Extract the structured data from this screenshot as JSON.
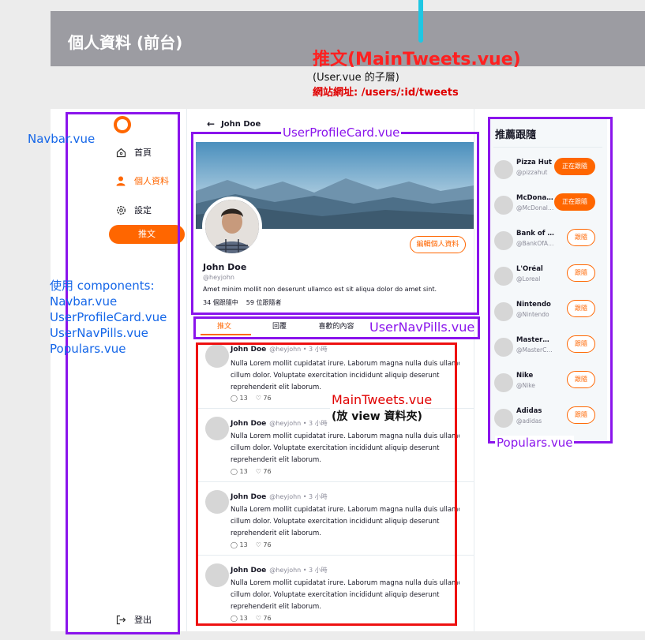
{
  "header": {
    "title": "個人資料 (前台)"
  },
  "annotation": {
    "main_title": "推文(MainTweets.vue)",
    "sub1": "(User.vue 的子層)",
    "sub2": "網站網址: /users/:id/tweets",
    "navbar_label": "Navbar.vue",
    "profilecard_label": "UserProfileCard.vue",
    "navpills_label": "UserNavPills.vue",
    "populars_label": "Populars.vue",
    "maintweets_label": "MainTweets.vue",
    "maintweets_sub": "(放 view 資料夾)",
    "components_title": "使用 components:",
    "components": [
      "Navbar.vue",
      "UserProfileCard.vue",
      "UserNavPills.vue",
      "Populars.vue"
    ]
  },
  "nav": {
    "items": [
      "首頁",
      "個人資料",
      "設定"
    ],
    "tweet_button": "推文",
    "logout": "登出",
    "accent": "#ff6600"
  },
  "profile": {
    "back_name": "John Doe",
    "name": "John Doe",
    "handle": "@heyjohn",
    "bio": "Amet minim mollit non deserunt ullamco est sit aliqua dolor do amet sint.",
    "following": "34 個跟隨中",
    "followers": "59 位跟隨者",
    "edit_button": "編輯個人資料"
  },
  "pills": [
    "推文",
    "回覆",
    "喜歡的內容"
  ],
  "tweets": [
    {
      "name": "John Doe",
      "handle": "@heyjohn • 3 小時",
      "lines": [
        "Nulla Lorem mollit cupidatat irure. Laborum magna nulla duis ullamco",
        "cillum dolor. Voluptate exercitation incididunt aliquip deserunt",
        "reprehenderit elit laborum."
      ],
      "replies": "13",
      "likes": "76"
    },
    {
      "name": "John Doe",
      "handle": "@heyjohn • 3 小時",
      "lines": [
        "Nulla Lorem mollit cupidatat irure. Laborum magna nulla duis ullamco",
        "cillum dolor. Voluptate exercitation incididunt aliquip deserunt",
        "reprehenderit elit laborum."
      ],
      "replies": "13",
      "likes": "76"
    },
    {
      "name": "John Doe",
      "handle": "@heyjohn • 3 小時",
      "lines": [
        "Nulla Lorem mollit cupidatat irure. Laborum magna nulla duis ullamco",
        "cillum dolor. Voluptate exercitation incididunt aliquip deserunt",
        "reprehenderit elit laborum."
      ],
      "replies": "13",
      "likes": "76"
    },
    {
      "name": "John Doe",
      "handle": "@heyjohn • 3 小時",
      "lines": [
        "Nulla Lorem mollit cupidatat irure. Laborum magna nulla duis ullamco",
        "cillum dolor. Voluptate exercitation incididunt aliquip deserunt",
        "reprehenderit elit laborum."
      ],
      "replies": "13",
      "likes": "76"
    }
  ],
  "populars": {
    "title": "推薦跟隨",
    "users": [
      {
        "name": "Pizza Hut",
        "handle": "@pizzahut",
        "button": "正在跟隨"
      },
      {
        "name": "McDonald's",
        "handle": "@McDonalds",
        "button": "正在跟隨"
      },
      {
        "name": "Bank of America",
        "handle": "@BankOfAmerica",
        "button": "跟隨"
      },
      {
        "name": "L'Oréal",
        "handle": "@Loreal",
        "button": "跟隨"
      },
      {
        "name": "Nintendo",
        "handle": "@Nintendo",
        "button": "跟隨"
      },
      {
        "name": "MasterCard",
        "handle": "@MasterCard",
        "button": "跟隨"
      },
      {
        "name": "Nike",
        "handle": "@Nike",
        "button": "跟隨"
      },
      {
        "name": "Adidas",
        "handle": "@adidas",
        "button": "跟隨"
      }
    ]
  }
}
